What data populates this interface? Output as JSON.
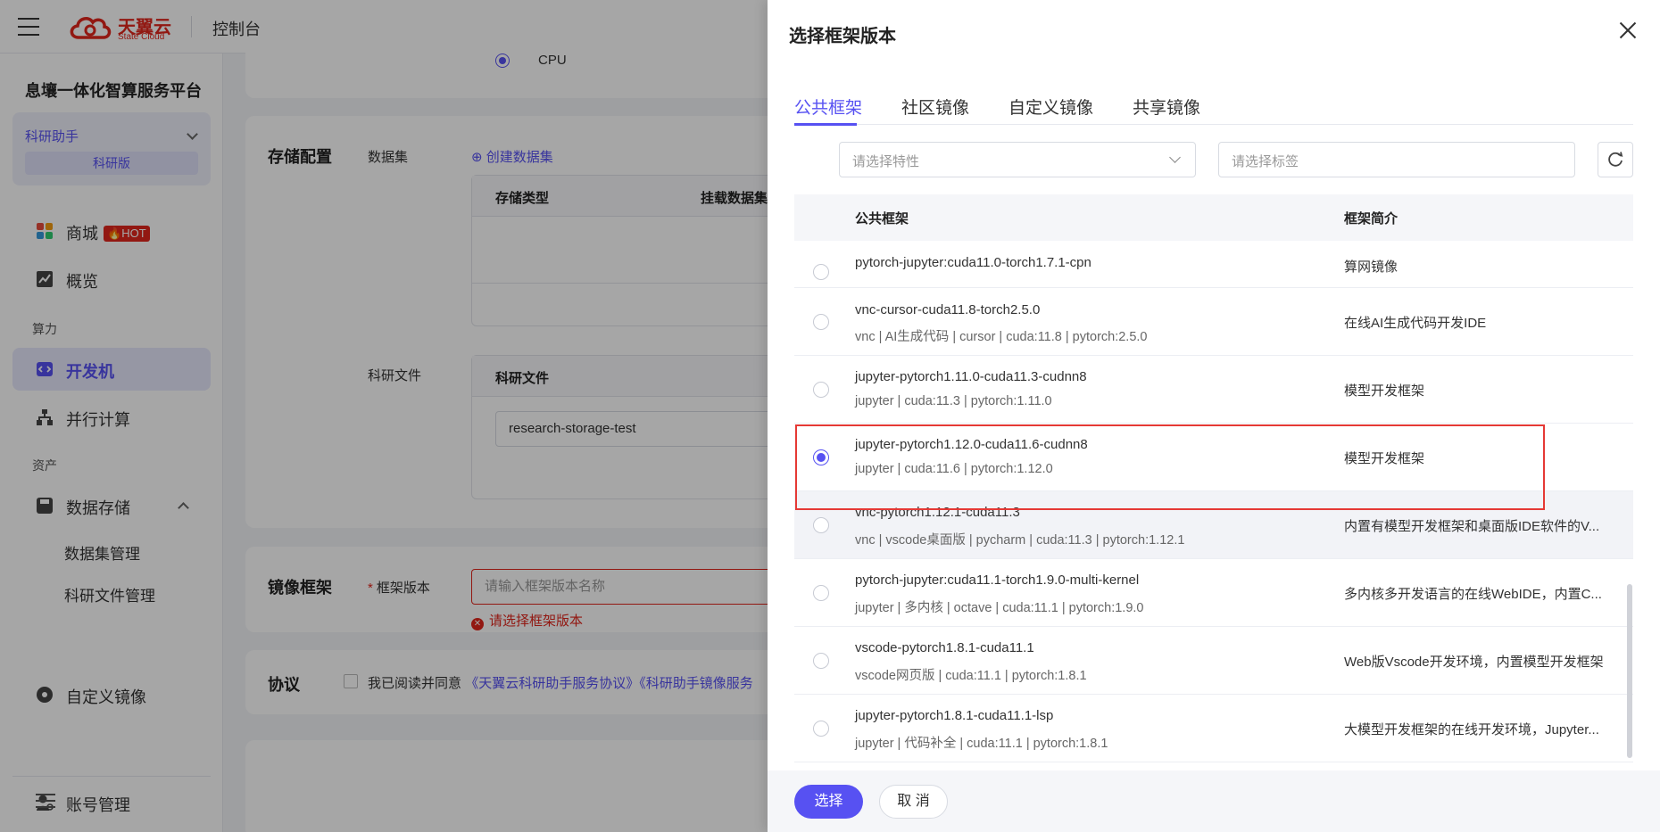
{
  "header": {
    "brand_name": "天翼云",
    "brand_sub": "State Cloud",
    "console": "控制台"
  },
  "sidebar": {
    "platform_title": "息壤一体化智算服务平台",
    "assistant": {
      "name": "科研助手",
      "edition": "科研版"
    },
    "items": [
      {
        "label": "商城",
        "badge": "HOT"
      },
      {
        "label": "概览"
      },
      {
        "group": "算力"
      },
      {
        "label": "开发机",
        "active": true
      },
      {
        "label": "并行计算"
      },
      {
        "group": "资产"
      },
      {
        "label": "数据存储"
      },
      {
        "label": "数据集管理"
      },
      {
        "label": "科研文件管理"
      },
      {
        "label": "自定义镜像"
      },
      {
        "label": "账号管理"
      }
    ]
  },
  "form": {
    "cpu_label": "CPU",
    "storage": {
      "title": "存储配置",
      "dataset_label": "数据集",
      "create_dataset": "创建数据集",
      "col_storage_type": "存储类型",
      "col_mount": "挂载数据集",
      "research_files_label": "科研文件",
      "research_files_header": "科研文件",
      "research_files_value": "research-storage-test"
    },
    "image": {
      "title": "镜像框架",
      "framework_label": "框架版本",
      "framework_placeholder": "请输入框架版本名称",
      "error": "请选择框架版本"
    },
    "agreement": {
      "title": "协议",
      "text": "我已阅读并同意",
      "link1": "《天翼云科研助手服务协议》",
      "link2": "《科研助手镜像服务"
    }
  },
  "drawer": {
    "title": "选择框架版本",
    "tabs": [
      "公共框架",
      "社区镜像",
      "自定义镜像",
      "共享镜像"
    ],
    "filter_placeholder": "请选择特性",
    "tag_placeholder": "请选择标签",
    "columns": {
      "name": "公共框架",
      "desc": "框架简介"
    },
    "rows": [
      {
        "name": "pytorch-jupyter:cuda11.0-torch1.7.1-cpn",
        "tags": "",
        "desc": "算网镜像",
        "selected": false
      },
      {
        "name": "vnc-cursor-cuda11.8-torch2.5.0",
        "tags": "vnc | AI生成代码 | cursor | cuda:11.8 | pytorch:2.5.0",
        "desc": "在线AI生成代码开发IDE",
        "selected": false
      },
      {
        "name": "jupyter-pytorch1.11.0-cuda11.3-cudnn8",
        "tags": "jupyter | cuda:11.3 | pytorch:1.11.0",
        "desc": "模型开发框架",
        "selected": false
      },
      {
        "name": "jupyter-pytorch1.12.0-cuda11.6-cudnn8",
        "tags": "jupyter | cuda:11.6 | pytorch:1.12.0",
        "desc": "模型开发框架",
        "selected": true
      },
      {
        "name": "vnc-pytorch1.12.1-cuda11.3",
        "tags": "vnc | vscode桌面版 | pycharm | cuda:11.3 | pytorch:1.12.1",
        "desc": "内置有模型开发框架和桌面版IDE软件的V...",
        "selected": false
      },
      {
        "name": "pytorch-jupyter:cuda11.1-torch1.9.0-multi-kernel",
        "tags": "jupyter | 多内核 | octave | cuda:11.1 | pytorch:1.9.0",
        "desc": "多内核多开发语言的在线WebIDE，内置C...",
        "selected": false
      },
      {
        "name": "vscode-pytorch1.8.1-cuda11.1",
        "tags": "vscode网页版 | cuda:11.1 | pytorch:1.8.1",
        "desc": "Web版Vscode开发环境，内置模型开发框架",
        "selected": false
      },
      {
        "name": "jupyter-pytorch1.8.1-cuda11.1-lsp",
        "tags": "jupyter | 代码补全 | cuda:11.1 | pytorch:1.8.1",
        "desc": "大模型开发框架的在线开发环境，Jupyter...",
        "selected": false
      }
    ],
    "confirm": "选择",
    "cancel": "取 消"
  }
}
